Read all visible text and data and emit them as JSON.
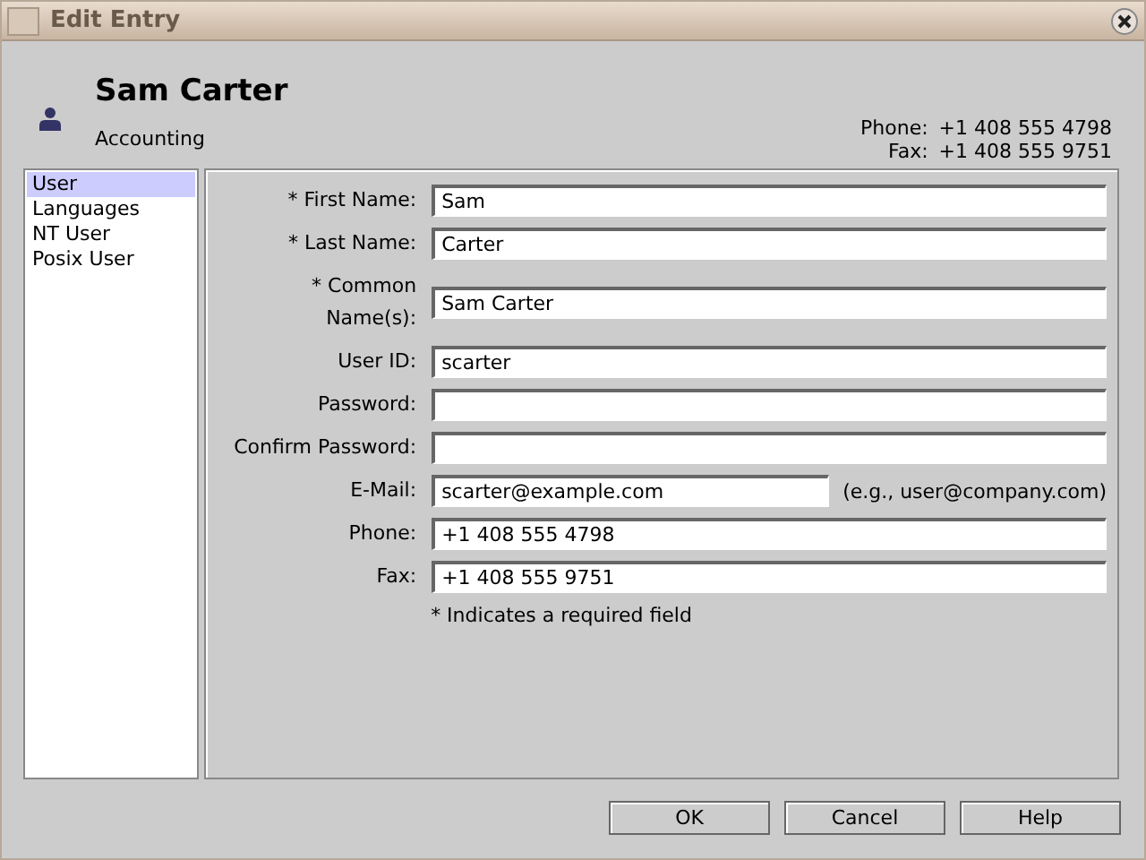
{
  "window": {
    "title": "Edit Entry"
  },
  "header": {
    "name": "Sam Carter",
    "department": "Accounting",
    "contacts": [
      {
        "label": "Phone:",
        "value": "+1 408 555 4798"
      },
      {
        "label": "Fax:",
        "value": "+1 408 555 9751"
      }
    ]
  },
  "sidebar": {
    "items": [
      {
        "label": "User",
        "selected": true
      },
      {
        "label": "Languages",
        "selected": false
      },
      {
        "label": "NT User",
        "selected": false
      },
      {
        "label": "Posix User",
        "selected": false
      }
    ]
  },
  "form": {
    "fields": [
      {
        "label": "* First Name:",
        "value": "Sam"
      },
      {
        "label": "* Last Name:",
        "value": "Carter"
      },
      {
        "label": "* Common Name(s):",
        "value": "Sam Carter"
      },
      {
        "label": "User ID:",
        "value": "scarter"
      },
      {
        "label": "Password:"
      },
      {
        "label": "Confirm Password:"
      },
      {
        "label": "E-Mail:",
        "value": "scarter@example.com",
        "hint": "(e.g., user@company.com)"
      },
      {
        "label": "Phone:",
        "value": "+1 408 555 4798"
      },
      {
        "label": "Fax:",
        "value": "+1 408 555 9751"
      }
    ],
    "note": "* Indicates a required field"
  },
  "buttons": [
    "OK",
    "Cancel",
    "Help"
  ]
}
